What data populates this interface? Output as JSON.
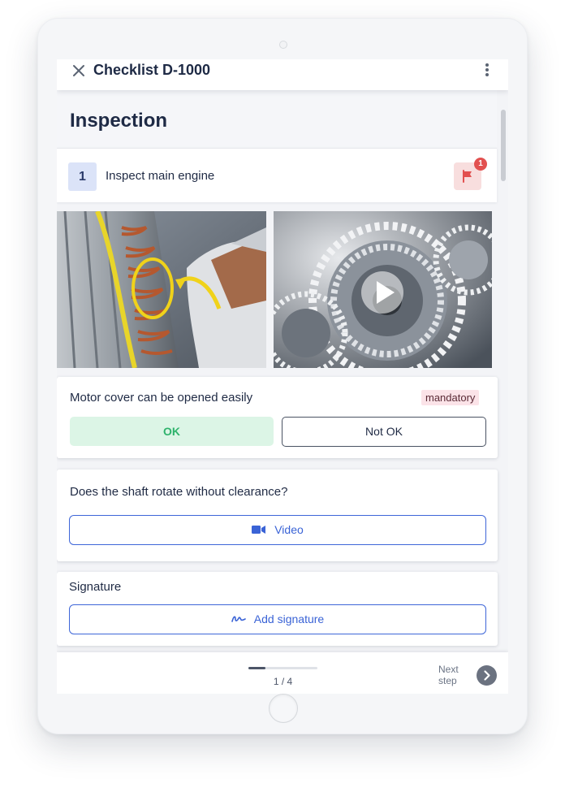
{
  "app_bar": {
    "title": "Checklist D-1000"
  },
  "section": {
    "title": "Inspection"
  },
  "step": {
    "number": "1",
    "title": "Inspect main engine",
    "flag_count": "1"
  },
  "checks": [
    {
      "question": "Motor cover can be opened easily",
      "badge": "mandatory",
      "ok_label": "OK",
      "not_ok_label": "Not OK"
    },
    {
      "question": "Does the shaft rotate without clearance?",
      "button_label": "Video"
    },
    {
      "question": "Signature",
      "button_label": "Add signature"
    }
  ],
  "footer": {
    "page": "1 / 4",
    "progress": 0.25,
    "next_line1": "Next",
    "next_line2": "step"
  },
  "colors": {
    "accent": "#3a63d6",
    "ok": "#2eb36c",
    "flag": "#e2504f",
    "mandatory_bg": "#fbe3e8"
  }
}
